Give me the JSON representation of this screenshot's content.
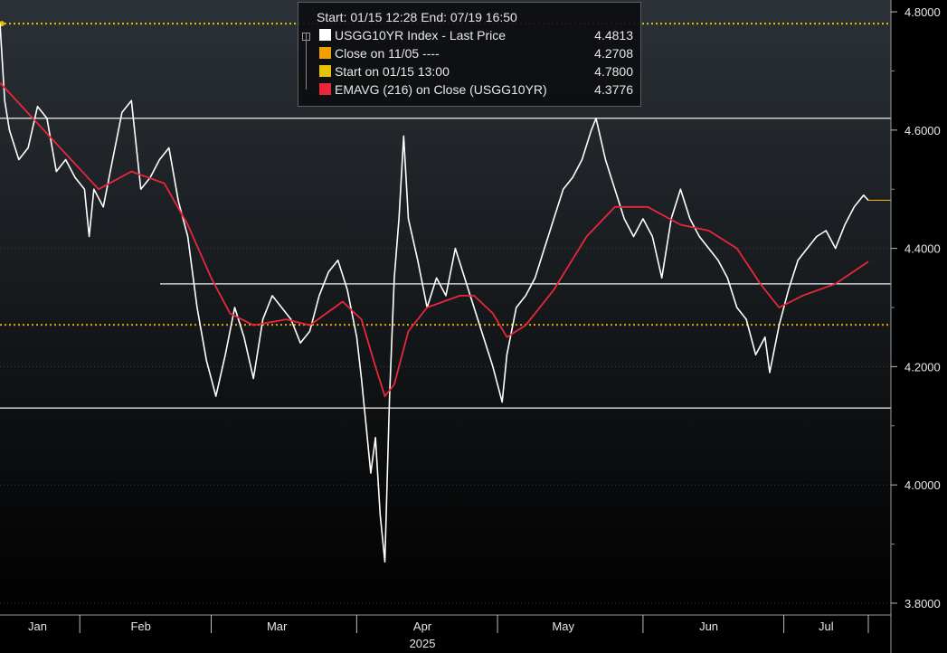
{
  "chart_data": {
    "type": "line",
    "legend": {
      "range_text": "Start: 01/15 12:28 End: 07/19 16:50",
      "entries": [
        {
          "name": "USGG10YR Index - Last Price",
          "value": "4.4813",
          "color": "#ffffff"
        },
        {
          "name": "Close on 11/05 ----",
          "value": "4.2708",
          "color": "#f0a000"
        },
        {
          "name": "Start on 01/15 13:00",
          "value": "4.7800",
          "color": "#e6c200"
        },
        {
          "name": "EMAVG (216)  on Close (USGG10YR)",
          "value": "4.3776",
          "color": "#e8273b"
        }
      ],
      "placement": "top-center"
    },
    "x_axis": {
      "months": [
        "Jan",
        "Feb",
        "Mar",
        "Apr",
        "May",
        "Jun",
        "Jul"
      ],
      "year": "2025",
      "range": [
        "2025-01-15",
        "2025-07-19"
      ]
    },
    "y_axis": {
      "ticks": [
        "3.8000",
        "4.0000",
        "4.2000",
        "4.4000",
        "4.6000",
        "4.8000"
      ],
      "range": [
        3.78,
        4.82
      ]
    },
    "reference_lines": {
      "horizontal_white": [
        4.62,
        4.34,
        4.13
      ],
      "close_dotted": 4.2708,
      "start_dotted": 4.78
    },
    "series": [
      {
        "name": "USGG10YR Index - Last Price",
        "color": "#ffffff",
        "points": [
          [
            "2025-01-15",
            4.78
          ],
          [
            "2025-01-16",
            4.65
          ],
          [
            "2025-01-17",
            4.6
          ],
          [
            "2025-01-19",
            4.55
          ],
          [
            "2025-01-21",
            4.57
          ],
          [
            "2025-01-23",
            4.64
          ],
          [
            "2025-01-25",
            4.62
          ],
          [
            "2025-01-27",
            4.53
          ],
          [
            "2025-01-29",
            4.55
          ],
          [
            "2025-01-31",
            4.52
          ],
          [
            "2025-02-02",
            4.5
          ],
          [
            "2025-02-03",
            4.42
          ],
          [
            "2025-02-04",
            4.5
          ],
          [
            "2025-02-06",
            4.47
          ],
          [
            "2025-02-08",
            4.55
          ],
          [
            "2025-02-10",
            4.63
          ],
          [
            "2025-02-12",
            4.65
          ],
          [
            "2025-02-14",
            4.5
          ],
          [
            "2025-02-16",
            4.52
          ],
          [
            "2025-02-18",
            4.55
          ],
          [
            "2025-02-20",
            4.57
          ],
          [
            "2025-02-22",
            4.48
          ],
          [
            "2025-02-24",
            4.42
          ],
          [
            "2025-02-26",
            4.3
          ],
          [
            "2025-02-28",
            4.21
          ],
          [
            "2025-03-02",
            4.15
          ],
          [
            "2025-03-04",
            4.22
          ],
          [
            "2025-03-06",
            4.3
          ],
          [
            "2025-03-08",
            4.25
          ],
          [
            "2025-03-10",
            4.18
          ],
          [
            "2025-03-12",
            4.28
          ],
          [
            "2025-03-14",
            4.32
          ],
          [
            "2025-03-16",
            4.3
          ],
          [
            "2025-03-18",
            4.28
          ],
          [
            "2025-03-20",
            4.24
          ],
          [
            "2025-03-22",
            4.26
          ],
          [
            "2025-03-24",
            4.32
          ],
          [
            "2025-03-26",
            4.36
          ],
          [
            "2025-03-28",
            4.38
          ],
          [
            "2025-03-30",
            4.33
          ],
          [
            "2025-04-01",
            4.25
          ],
          [
            "2025-04-02",
            4.18
          ],
          [
            "2025-04-03",
            4.1
          ],
          [
            "2025-04-04",
            4.02
          ],
          [
            "2025-04-05",
            4.08
          ],
          [
            "2025-04-06",
            3.95
          ],
          [
            "2025-04-07",
            3.87
          ],
          [
            "2025-04-08",
            4.15
          ],
          [
            "2025-04-09",
            4.35
          ],
          [
            "2025-04-10",
            4.45
          ],
          [
            "2025-04-11",
            4.59
          ],
          [
            "2025-04-12",
            4.45
          ],
          [
            "2025-04-14",
            4.38
          ],
          [
            "2025-04-16",
            4.3
          ],
          [
            "2025-04-18",
            4.35
          ],
          [
            "2025-04-20",
            4.32
          ],
          [
            "2025-04-22",
            4.4
          ],
          [
            "2025-04-24",
            4.35
          ],
          [
            "2025-04-26",
            4.3
          ],
          [
            "2025-04-28",
            4.25
          ],
          [
            "2025-04-30",
            4.2
          ],
          [
            "2025-05-02",
            4.14
          ],
          [
            "2025-05-03",
            4.22
          ],
          [
            "2025-05-05",
            4.3
          ],
          [
            "2025-05-07",
            4.32
          ],
          [
            "2025-05-09",
            4.35
          ],
          [
            "2025-05-11",
            4.4
          ],
          [
            "2025-05-13",
            4.45
          ],
          [
            "2025-05-15",
            4.5
          ],
          [
            "2025-05-17",
            4.52
          ],
          [
            "2025-05-19",
            4.55
          ],
          [
            "2025-05-21",
            4.6
          ],
          [
            "2025-05-22",
            4.62
          ],
          [
            "2025-05-24",
            4.55
          ],
          [
            "2025-05-26",
            4.5
          ],
          [
            "2025-05-28",
            4.45
          ],
          [
            "2025-05-30",
            4.42
          ],
          [
            "2025-06-01",
            4.45
          ],
          [
            "2025-06-03",
            4.42
          ],
          [
            "2025-06-05",
            4.35
          ],
          [
            "2025-06-07",
            4.45
          ],
          [
            "2025-06-09",
            4.5
          ],
          [
            "2025-06-11",
            4.45
          ],
          [
            "2025-06-13",
            4.42
          ],
          [
            "2025-06-15",
            4.4
          ],
          [
            "2025-06-17",
            4.38
          ],
          [
            "2025-06-19",
            4.35
          ],
          [
            "2025-06-21",
            4.3
          ],
          [
            "2025-06-23",
            4.28
          ],
          [
            "2025-06-25",
            4.22
          ],
          [
            "2025-06-27",
            4.25
          ],
          [
            "2025-06-28",
            4.19
          ],
          [
            "2025-06-30",
            4.27
          ],
          [
            "2025-07-02",
            4.33
          ],
          [
            "2025-07-04",
            4.38
          ],
          [
            "2025-07-06",
            4.4
          ],
          [
            "2025-07-08",
            4.42
          ],
          [
            "2025-07-10",
            4.43
          ],
          [
            "2025-07-12",
            4.4
          ],
          [
            "2025-07-14",
            4.44
          ],
          [
            "2025-07-16",
            4.47
          ],
          [
            "2025-07-18",
            4.49
          ],
          [
            "2025-07-19",
            4.4813
          ]
        ]
      },
      {
        "name": "EMAVG (216)  on Close (USGG10YR)",
        "color": "#e8273b",
        "points": [
          [
            "2025-01-15",
            4.68
          ],
          [
            "2025-01-22",
            4.62
          ],
          [
            "2025-01-29",
            4.56
          ],
          [
            "2025-02-05",
            4.5
          ],
          [
            "2025-02-12",
            4.53
          ],
          [
            "2025-02-19",
            4.51
          ],
          [
            "2025-02-24",
            4.44
          ],
          [
            "2025-03-01",
            4.35
          ],
          [
            "2025-03-05",
            4.29
          ],
          [
            "2025-03-10",
            4.27
          ],
          [
            "2025-03-17",
            4.28
          ],
          [
            "2025-03-22",
            4.27
          ],
          [
            "2025-03-29",
            4.31
          ],
          [
            "2025-04-02",
            4.28
          ],
          [
            "2025-04-05",
            4.2
          ],
          [
            "2025-04-07",
            4.15
          ],
          [
            "2025-04-09",
            4.17
          ],
          [
            "2025-04-12",
            4.26
          ],
          [
            "2025-04-16",
            4.3
          ],
          [
            "2025-04-23",
            4.32
          ],
          [
            "2025-04-26",
            4.32
          ],
          [
            "2025-04-30",
            4.29
          ],
          [
            "2025-05-03",
            4.25
          ],
          [
            "2025-05-07",
            4.27
          ],
          [
            "2025-05-13",
            4.33
          ],
          [
            "2025-05-20",
            4.42
          ],
          [
            "2025-05-26",
            4.47
          ],
          [
            "2025-06-02",
            4.47
          ],
          [
            "2025-06-09",
            4.44
          ],
          [
            "2025-06-15",
            4.43
          ],
          [
            "2025-06-21",
            4.4
          ],
          [
            "2025-06-26",
            4.34
          ],
          [
            "2025-06-30",
            4.3
          ],
          [
            "2025-07-05",
            4.32
          ],
          [
            "2025-07-12",
            4.34
          ],
          [
            "2025-07-19",
            4.3776
          ]
        ]
      }
    ]
  }
}
